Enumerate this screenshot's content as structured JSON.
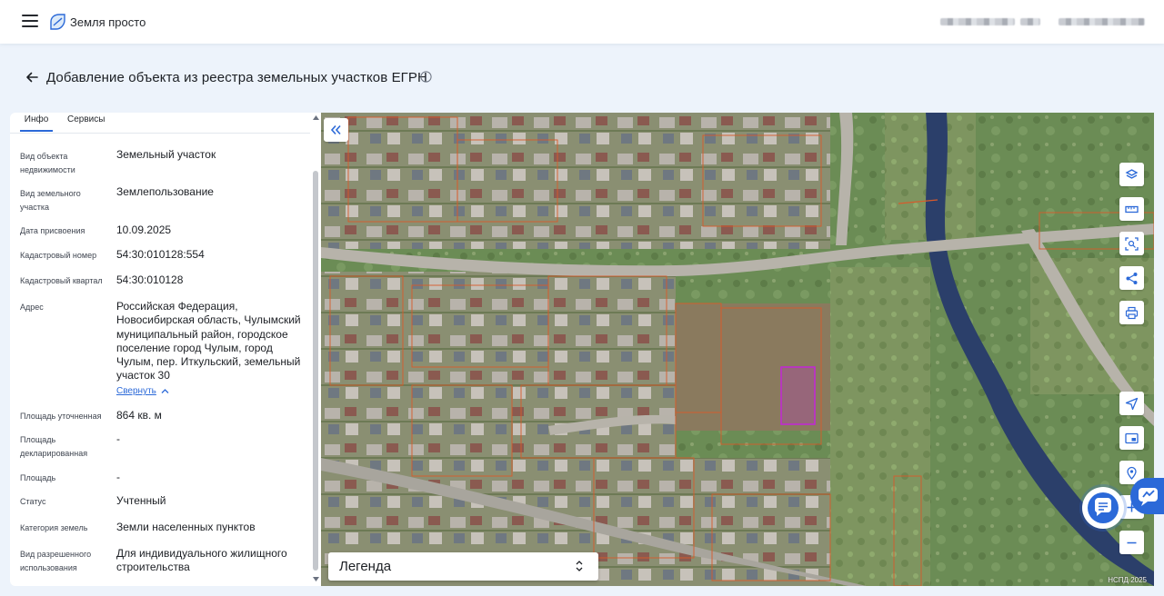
{
  "header": {
    "brand": "Земля просто",
    "menu_icon": "hamburger-menu-icon",
    "logo_icon": "leaf-logo-icon"
  },
  "page": {
    "title": "Добавление объекта из реестра земельных участков ЕГРН",
    "back_icon": "arrow-left-icon",
    "info_icon": "info-circle-icon"
  },
  "tabs": [
    {
      "label": "Инфо",
      "active": true
    },
    {
      "label": "Сервисы",
      "active": false
    }
  ],
  "properties": [
    {
      "label": "Вид объекта недвижимости",
      "value": "Земельный участок"
    },
    {
      "label": "Вид земельного участка",
      "value": "Землепользование"
    },
    {
      "label": "Дата присвоения",
      "value": "10.09.2025"
    },
    {
      "label": "Кадастровый номер",
      "value": "54:30:010128:554"
    },
    {
      "label": "Кадастровый квартал",
      "value": "54:30:010128"
    },
    {
      "label": "Адрес",
      "value": "Российская Федерация, Новосибирская область, Чулымский муниципальный район, городское поселение город Чулым, город Чулым, пер. Иткульский, земельный участок 30"
    },
    {
      "label": "Площадь уточненная",
      "value": "864 кв. м"
    },
    {
      "label": "Площадь декларированная",
      "value": "-"
    },
    {
      "label": "Площадь",
      "value": "-"
    },
    {
      "label": "Статус",
      "value": "Учтенный"
    },
    {
      "label": "Категория земель",
      "value": "Земли населенных пунктов"
    },
    {
      "label": "Вид разрешенного использования",
      "value": "Для индивидуального жилищного строительства"
    }
  ],
  "address_toggle": "Свернуть",
  "map": {
    "legend_label": "Легенда",
    "attribution": "НСПД 2025",
    "tools": [
      "layers-icon",
      "ruler-icon",
      "select-area-icon",
      "share-icon",
      "print-icon",
      "locate-icon",
      "minimap-icon",
      "place-marker-icon",
      "zoom-in-icon",
      "zoom-out-icon"
    ],
    "accent_color": "#2b69d8",
    "selected_parcel_color": "#c02ad0",
    "parcel_border_color": "#d95a2a"
  }
}
